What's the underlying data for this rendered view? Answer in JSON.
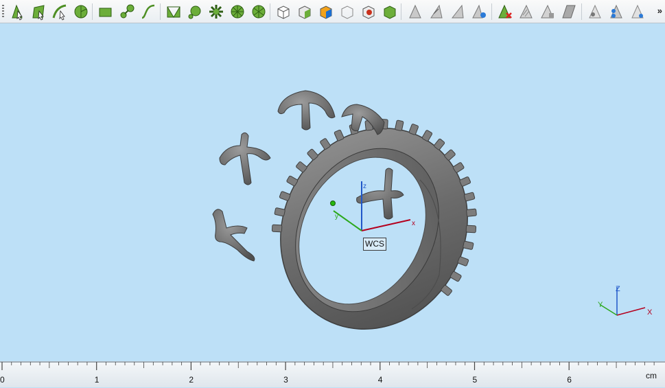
{
  "toolbar": {
    "buttons": [
      "select-point-icon",
      "select-face-icon",
      "select-curve-icon",
      "select-circle-icon",
      "rectangle-select-icon",
      "node-select-icon",
      "spline-select-icon",
      "mesh-select-icon",
      "mesh-node-icon",
      "mesh-spokes-icon",
      "mesh-radial-icon",
      "mesh-wheel-icon",
      "cube-view-icon",
      "cube-front-icon",
      "cube-color-icon",
      "cube-wire-icon",
      "cube-red-icon",
      "cube-green-icon",
      "surface-gray-icon",
      "surface-edit-icon",
      "surface-move-icon",
      "surface-globe-icon",
      "surface-delete-icon",
      "surface-hatch-icon",
      "surface-copy-icon",
      "surface-shade-icon",
      "visibility-icon",
      "visibility-layers-icon",
      "visibility-eye-icon"
    ],
    "overflow_label": "»"
  },
  "viewport": {
    "wcs_label": "WCS",
    "axes": {
      "x": "x",
      "y": "y",
      "z": "z"
    },
    "corner_axes": {
      "x": "X",
      "y": "Y",
      "z": "Z"
    }
  },
  "ruler": {
    "ticks": [
      "0",
      "1",
      "2",
      "3",
      "4",
      "5",
      "6"
    ],
    "unit": "cm"
  },
  "colors": {
    "viewport_bg": "#bde0f7",
    "model": "#6f6f6f",
    "x_axis": "#b4001e",
    "y_axis": "#2ca81c",
    "z_axis": "#1f56c9"
  }
}
